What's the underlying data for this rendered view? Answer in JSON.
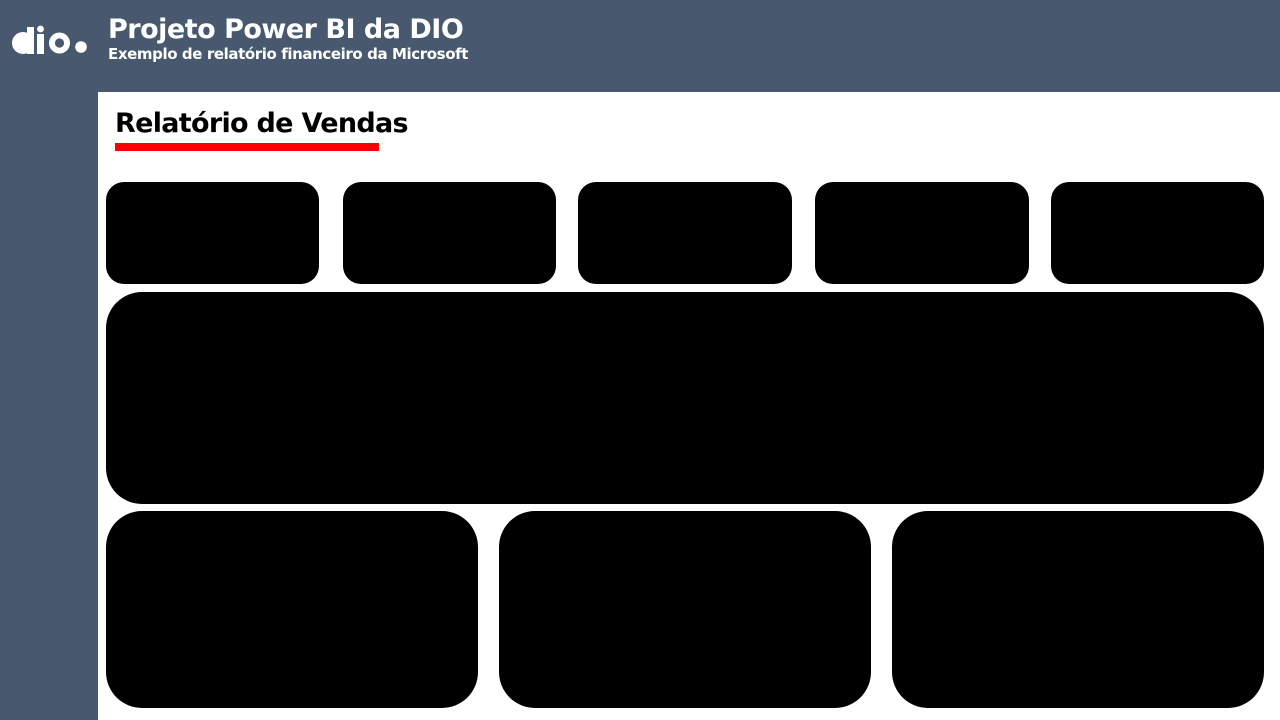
{
  "header": {
    "logo_name": "dio-logo",
    "title": "Projeto Power BI da DIO",
    "subtitle": "Exemplo de relatório financeiro da Microsoft"
  },
  "report": {
    "title": "Relatório de Vendas",
    "kpi_cards": [
      {
        "label": ""
      },
      {
        "label": ""
      },
      {
        "label": ""
      },
      {
        "label": ""
      },
      {
        "label": ""
      }
    ],
    "main_visual": {
      "label": ""
    },
    "bottom_visuals": [
      {
        "label": ""
      },
      {
        "label": ""
      },
      {
        "label": ""
      }
    ]
  },
  "colors": {
    "header_bg": "#48586e",
    "sidebar_bg": "#48586e",
    "canvas_bg": "#ffffff",
    "accent_underline": "#ff0000",
    "placeholder_fill": "#000000",
    "header_text": "#ffffff",
    "title_text": "#000000"
  }
}
